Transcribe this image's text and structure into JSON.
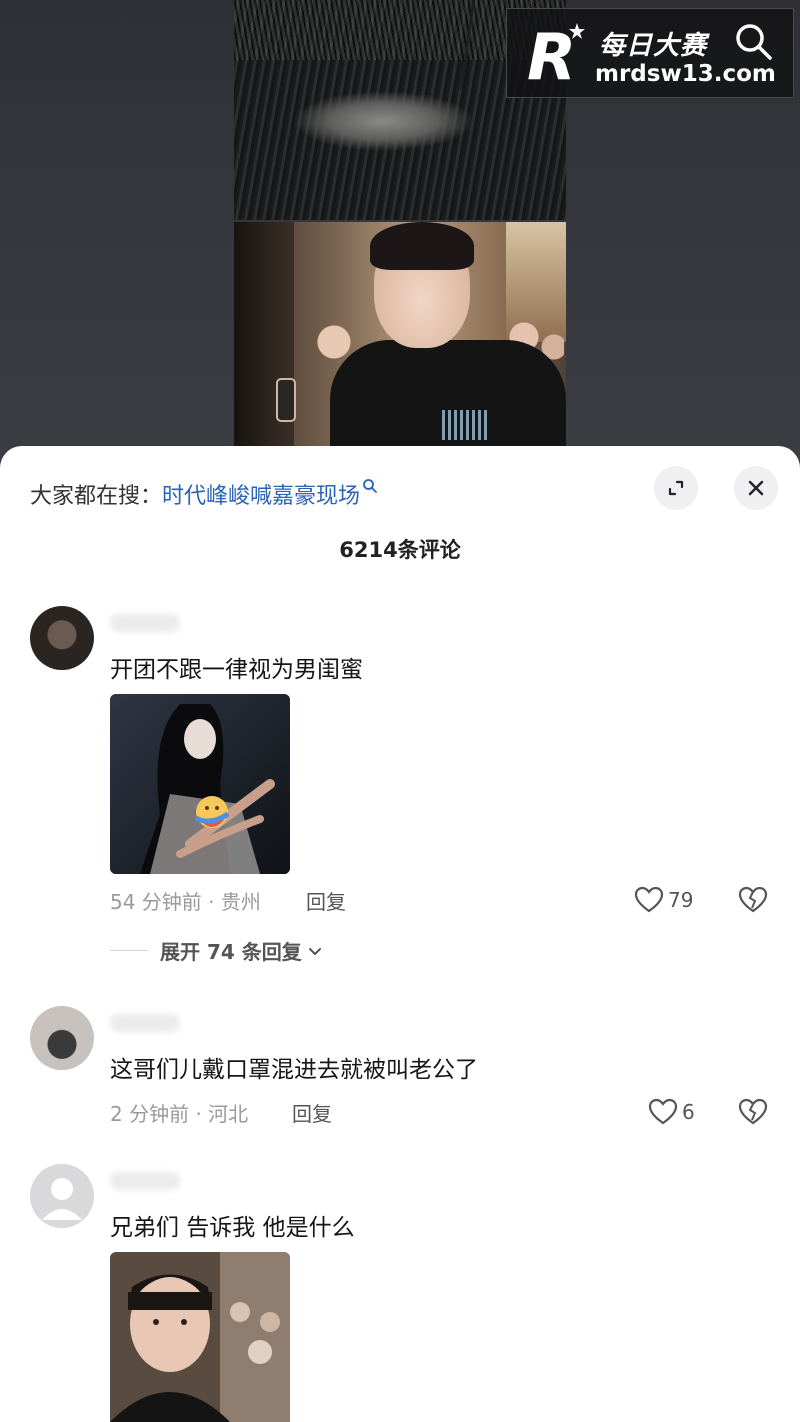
{
  "watermark": {
    "brand": "每日大赛",
    "url": "mrdsw13.com",
    "logo_letter": "R",
    "icons": [
      "logo-r-star",
      "search-icon"
    ]
  },
  "panel": {
    "search_prefix": "大家都在搜：",
    "search_term": "时代峰峻喊嘉豪现场",
    "comment_count_title": "6214条评论",
    "icons": [
      "search-small-icon",
      "expand-icon",
      "close-icon"
    ]
  },
  "comments": [
    {
      "text": "开团不跟一律视为男闺蜜",
      "has_image": true,
      "image_desc_icon": "emoji-hug-icon",
      "time_location": "54 分钟前 · 贵州",
      "reply_label": "回复",
      "likes": "79",
      "expand_replies": "展开 74 条回复"
    },
    {
      "text": "这哥们儿戴口罩混进去就被叫老公了",
      "has_image": false,
      "time_location": "2 分钟前 · 河北",
      "reply_label": "回复",
      "likes": "6"
    },
    {
      "text": "兄弟们 告诉我 他是什么",
      "has_image": true
    }
  ],
  "colors": {
    "link_blue": "#2a63b7",
    "meta_gray": "#9a9a9a",
    "panel_bg": "#ffffff",
    "backdrop": "#34363c"
  }
}
